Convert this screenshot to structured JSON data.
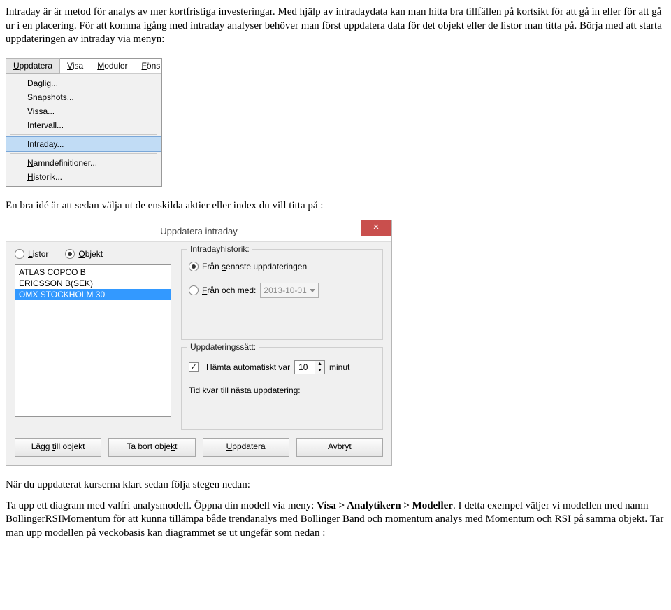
{
  "para1": "Intraday är är metod för analys av mer kortfristiga investeringar. Med hjälp av intradaydata kan man hitta bra tillfällen på kortsikt för att gå in eller för att gå ur i en placering. För att komma igång med intraday analyser behöver man först uppdatera data för det objekt eller de listor man titta på. Börja med att starta uppdateringen av intraday via menyn:",
  "menu": {
    "items": [
      "Uppdatera",
      "Visa",
      "Moduler",
      "Föns"
    ],
    "ulpos": [
      0,
      0,
      0,
      0
    ],
    "dd": [
      "Daglig...",
      "Snapshots...",
      "Vissa...",
      "Intervall...",
      "Intraday...",
      "Namndefinitioner...",
      "Historik..."
    ],
    "ddul": [
      0,
      0,
      0,
      5,
      1,
      0,
      0
    ]
  },
  "para2": "En bra idé är att sedan välja ut de enskilda aktier eller index du vill titta på :",
  "dialog": {
    "title": "Uppdatera intraday",
    "radio_listor": "Listor",
    "radio_objekt": "Objekt",
    "list": [
      "ATLAS COPCO B",
      "ERICSSON B(SEK)",
      "OMX STOCKHOLM 30"
    ],
    "grp_hist": "Intradayhistorik:",
    "opt_senaste": "Från senaste uppdateringen",
    "opt_fran": "Från och med:",
    "date": "2013-10-01",
    "grp_sett": "Uppdateringssätt:",
    "chk_auto_pre": "Hämta ",
    "chk_auto_mid": "automatiskt var",
    "interval": "10",
    "minut": "minut",
    "next_lbl": "Tid kvar till nästa uppdatering:",
    "btn_add": "Lägg till objekt",
    "btn_remove": "Ta bort objekt",
    "btn_update": "Uppdatera",
    "btn_cancel": "Avbryt"
  },
  "para3": "När du uppdaterat kurserna klart sedan följa stegen nedan:",
  "para4a": "Ta upp ett diagram med valfri analysmodell. Öppna din modell via meny: ",
  "para4b": "Visa > Analytikern > Modeller",
  "para4c": ". I detta exempel väljer vi modellen med namn BollingerRSIMomentum för att kunna tillämpa både trendanalys med Bollinger Band och momentum analys med Momentum och RSI på samma objekt. Tar man upp modellen på veckobasis kan diagrammet se ut ungefär som nedan :"
}
